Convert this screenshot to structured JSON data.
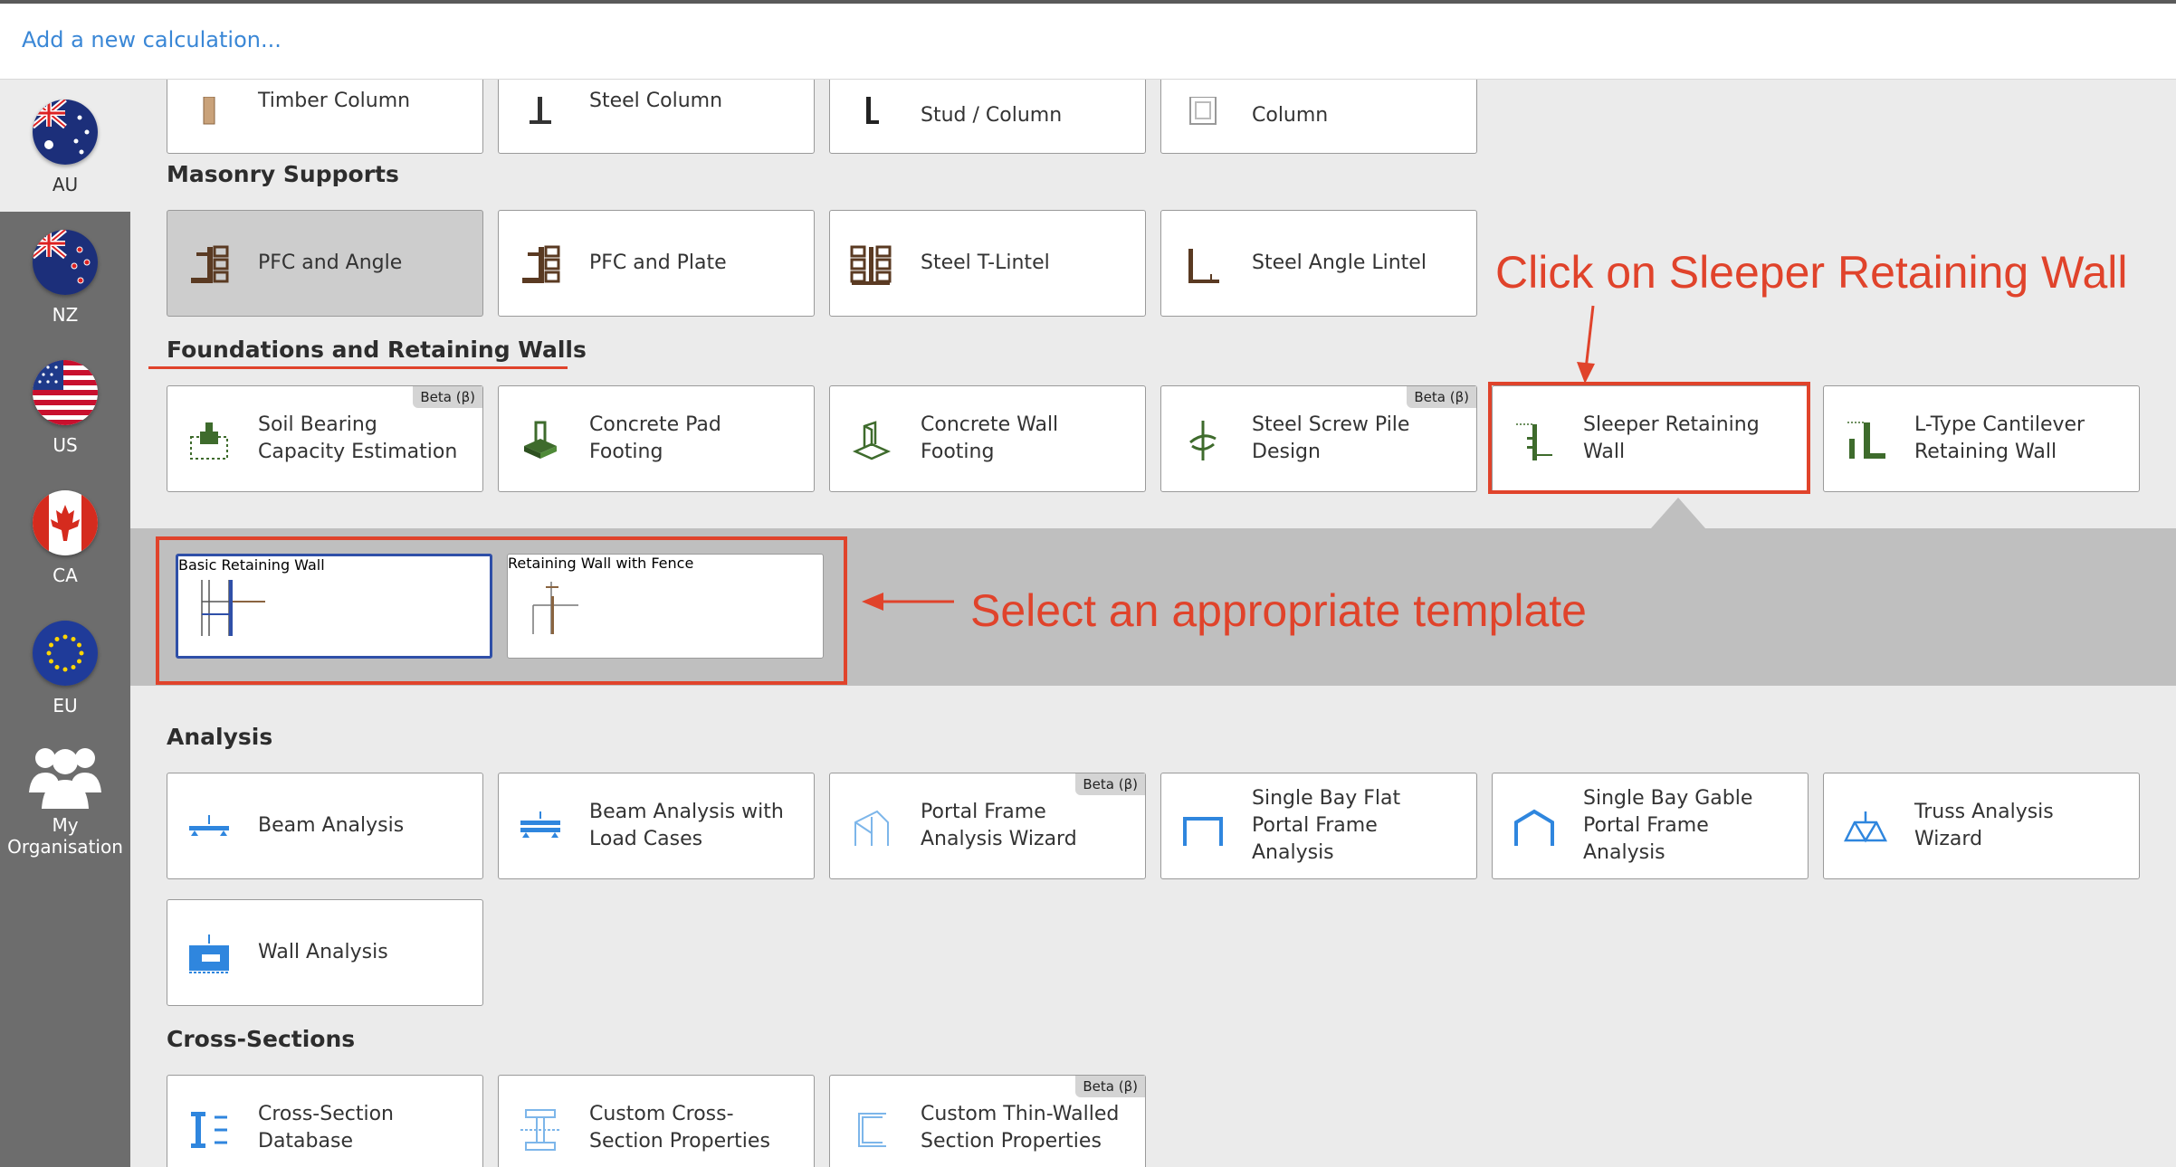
{
  "topbar": {
    "add_link": "Add a new calculation..."
  },
  "sidebar": {
    "regions": [
      {
        "code": "AU"
      },
      {
        "code": "NZ"
      },
      {
        "code": "US"
      },
      {
        "code": "CA"
      },
      {
        "code": "EU"
      }
    ],
    "organisation": {
      "label_line1": "My",
      "label_line2": "Organisation"
    }
  },
  "partial_row": [
    {
      "label": "Timber Column",
      "icon": "timber-column-icon"
    },
    {
      "label": "Steel Column",
      "icon": "steel-column-icon"
    },
    {
      "label": "Stud / Column",
      "icon": "stud-column-icon"
    },
    {
      "label": "Column",
      "icon": "concrete-column-icon"
    }
  ],
  "sections": {
    "masonry": {
      "title": "Masonry Supports",
      "items": [
        {
          "label": "PFC and Angle",
          "icon": "pfc-angle-icon"
        },
        {
          "label": "PFC and Plate",
          "icon": "pfc-plate-icon"
        },
        {
          "label": "Steel T-Lintel",
          "icon": "t-lintel-icon"
        },
        {
          "label": "Steel Angle Lintel",
          "icon": "angle-lintel-icon"
        }
      ]
    },
    "foundations": {
      "title": "Foundations and Retaining Walls",
      "items": [
        {
          "label": "Soil Bearing Capacity Estimation",
          "icon": "soil-bearing-icon",
          "badge": "Beta (β)"
        },
        {
          "label": "Concrete Pad Footing",
          "icon": "pad-footing-icon"
        },
        {
          "label": "Concrete Wall Footing",
          "icon": "wall-footing-icon"
        },
        {
          "label": "Steel Screw Pile Design",
          "icon": "screw-pile-icon",
          "badge": "Beta (β)"
        },
        {
          "label": "Sleeper Retaining Wall",
          "icon": "sleeper-wall-icon"
        },
        {
          "label": "L-Type Cantilever Retaining Wall",
          "icon": "l-type-wall-icon"
        }
      ],
      "templates": [
        {
          "label": "Basic Retaining Wall",
          "icon": "basic-wall-template-icon",
          "selected": true
        },
        {
          "label": "Retaining Wall with Fence",
          "icon": "fence-wall-template-icon",
          "selected": false
        }
      ]
    },
    "analysis": {
      "title": "Analysis",
      "items": [
        {
          "label": "Beam Analysis",
          "icon": "beam-analysis-icon"
        },
        {
          "label": "Beam Analysis with Load Cases",
          "icon": "beam-load-cases-icon"
        },
        {
          "label": "Portal Frame Analysis Wizard",
          "icon": "portal-frame-icon",
          "badge": "Beta (β)"
        },
        {
          "label": "Single Bay Flat Portal Frame Analysis",
          "icon": "flat-portal-icon"
        },
        {
          "label": "Single Bay Gable Portal Frame Analysis",
          "icon": "gable-portal-icon"
        },
        {
          "label": "Truss Analysis Wizard",
          "icon": "truss-icon"
        },
        {
          "label": "Wall Analysis",
          "icon": "wall-analysis-icon"
        }
      ]
    },
    "cross_sections": {
      "title": "Cross-Sections",
      "items": [
        {
          "label": "Cross-Section Database",
          "icon": "cross-section-db-icon"
        },
        {
          "label": "Custom Cross-Section Properties",
          "icon": "custom-section-icon"
        },
        {
          "label": "Custom Thin-Walled Section Properties",
          "icon": "thin-walled-icon",
          "badge": "Beta (β)"
        }
      ]
    }
  },
  "annotations": {
    "click_hint": "Click on Sleeper Retaining Wall",
    "template_hint": "Select an appropriate template"
  },
  "colors": {
    "annotation": "#e0432b",
    "link": "#3a87d6",
    "selected_border": "#2f4fa8",
    "analysis_blue": "#2f86de",
    "masonry_brown": "#5a3a22",
    "foundation_green": "#3e6b2c"
  }
}
